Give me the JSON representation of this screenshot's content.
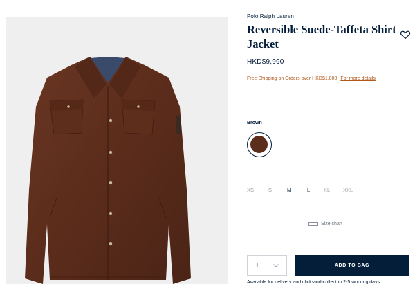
{
  "product": {
    "brand": "Polo Ralph Lauren",
    "title": "Reversible Suede-Taffeta Shirt Jacket",
    "price": "HKD$9,990",
    "image_alt": "Brown suede shirt jacket",
    "favorite_icon": "heart-icon"
  },
  "shipping": {
    "text": "Free Shipping on Orders over HKD$1,000",
    "link": "For more details",
    "color": "#b1591b"
  },
  "color": {
    "label": "Brown",
    "swatch": "#5a2d1c"
  },
  "sizes": [
    {
      "label": "XS",
      "available": false
    },
    {
      "label": "S",
      "available": false
    },
    {
      "label": "M",
      "available": true
    },
    {
      "label": "L",
      "available": true
    },
    {
      "label": "XL",
      "available": false
    },
    {
      "label": "XXL",
      "available": false
    }
  ],
  "size_chart": {
    "label": "Size chart",
    "icon": "ruler-icon"
  },
  "purchase": {
    "quantity": "1",
    "add_to_bag": "ADD TO BAG",
    "button_color": "#041e3a"
  },
  "cut_text": "Available for delivery and click-and-collect in 2-5 working days"
}
